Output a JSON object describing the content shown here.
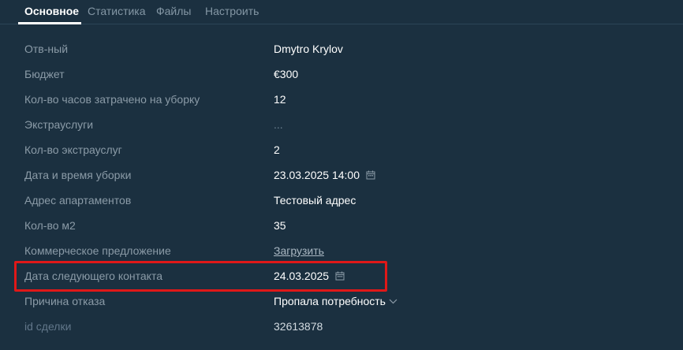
{
  "tabs": [
    {
      "label": "Основное",
      "active": true
    },
    {
      "label": "Статистика",
      "active": false
    },
    {
      "label": "Файлы",
      "active": false
    },
    {
      "label": "Настроить",
      "active": false
    }
  ],
  "fields": {
    "responsible": {
      "label": "Отв-ный",
      "value": "Dmytro Krylov"
    },
    "budget": {
      "label": "Бюджет",
      "value": "€300"
    },
    "cleaning_hours": {
      "label": "Кол-во часов затрачено на уборку",
      "value": "12"
    },
    "extra_services": {
      "label": "Экстрауслуги",
      "value": "..."
    },
    "extra_services_count": {
      "label": "Кол-во экстрауслуг",
      "value": "2"
    },
    "cleaning_datetime": {
      "label": "Дата и время уборки",
      "value": "23.03.2025 14:00",
      "icon": "calendar-icon"
    },
    "apartment_address": {
      "label": "Адрес апартаментов",
      "value": "Тестовый адрес"
    },
    "area_m2": {
      "label": "Кол-во м2",
      "value": "35"
    },
    "commercial_offer": {
      "label": "Коммерческое предложение",
      "value": "Загрузить"
    },
    "next_contact_date": {
      "label": "Дата следующего контакта",
      "value": "24.03.2025",
      "icon": "calendar-icon"
    },
    "refusal_reason": {
      "label": "Причина отказа",
      "value": "Пропала потребность",
      "icon": "chevron-down-icon"
    },
    "deal_id": {
      "label": "id сделки",
      "value": "32613878"
    }
  },
  "colors": {
    "background": "#1b3040",
    "highlight": "#e01818",
    "label": "#8b9ba7",
    "value": "#ffffff"
  }
}
